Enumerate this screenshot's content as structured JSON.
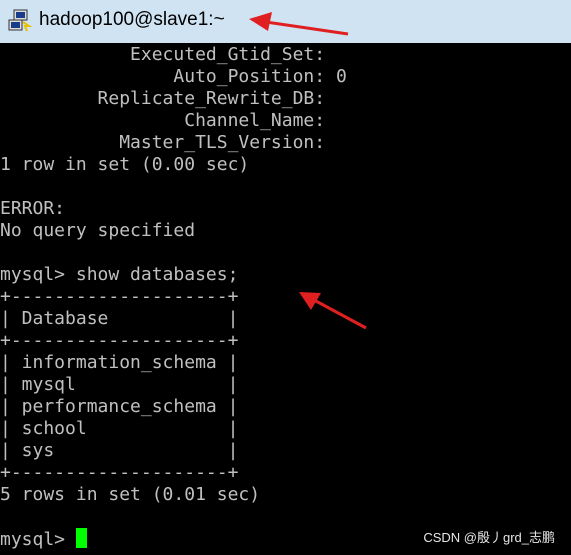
{
  "window": {
    "title": "hadoop100@slave1:~",
    "icon": "putty-terminal-icon"
  },
  "terminal": {
    "lines": [
      "            Executed_Gtid_Set:",
      "                Auto_Position: 0",
      "         Replicate_Rewrite_DB:",
      "                 Channel_Name:",
      "           Master_TLS_Version:",
      "1 row in set (0.00 sec)",
      "",
      "ERROR:",
      "No query specified",
      "",
      "mysql> show databases;",
      "+--------------------+",
      "| Database           |",
      "+--------------------+",
      "| information_schema |",
      "| mysql              |",
      "| performance_schema |",
      "| school             |",
      "| sys                |",
      "+--------------------+",
      "5 rows in set (0.01 sec)",
      "",
      "mysql> "
    ],
    "cursor_color": "#00ff00"
  },
  "watermark": "CSDN @殷丿grd_志鹏",
  "colors": {
    "titlebar": "#cfe3f3",
    "background": "#000000",
    "text": "#c0c0c0",
    "annotation_arrow": "#e02020"
  }
}
